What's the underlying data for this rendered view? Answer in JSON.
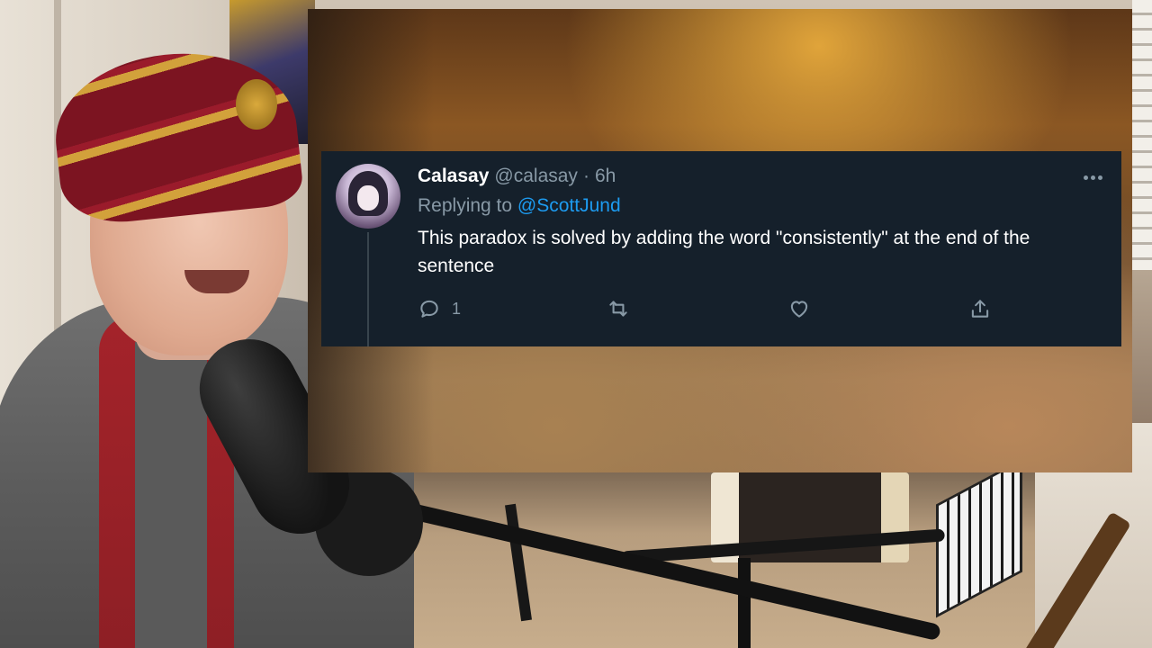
{
  "tweet": {
    "display_name": "Calasay",
    "handle": "@calasay",
    "separator": "·",
    "time": "6h",
    "replying_prefix": "Replying to",
    "replying_to": "@ScottJund",
    "text": "This paradox is solved by adding the word \"consistently\" at the end of the sentence",
    "reply_count": "1",
    "more_icon": "more-horizontal-icon",
    "action_icons": [
      "reply-icon",
      "retweet-icon",
      "like-icon",
      "share-icon"
    ]
  },
  "colors": {
    "card_background": "#15202b",
    "primary_text": "#ffffff",
    "secondary_text": "#8899a6",
    "link": "#1d9bf0"
  }
}
